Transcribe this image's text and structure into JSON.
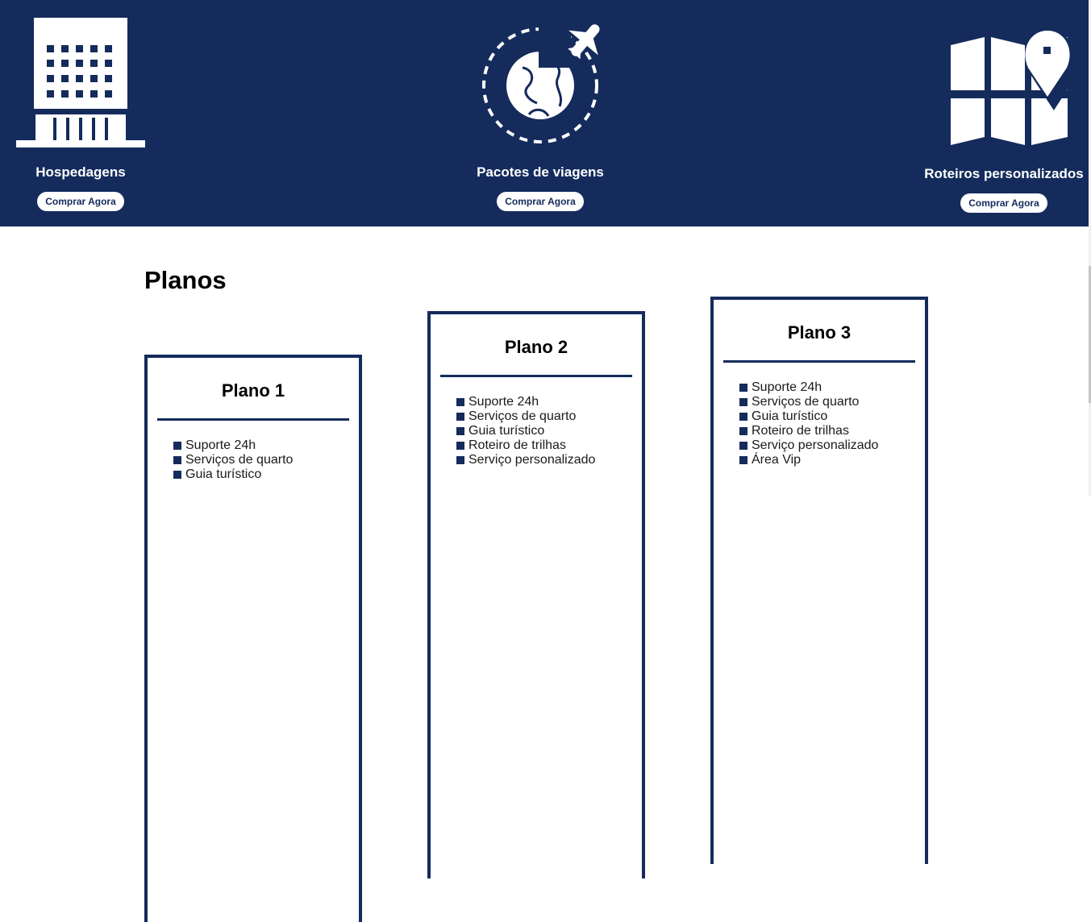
{
  "colors": {
    "navy": "#142b5c",
    "white": "#ffffff"
  },
  "services": [
    {
      "title": "Hospedagens",
      "button": "Comprar Agora",
      "icon": "hotel-building-icon"
    },
    {
      "title": "Pacotes de viagens",
      "button": "Comprar Agora",
      "icon": "globe-airplane-icon"
    },
    {
      "title": "Roteiros personalizados",
      "button": "Comprar Agora",
      "icon": "map-pin-icon"
    }
  ],
  "plans_section": {
    "title": "Planos"
  },
  "plans": [
    {
      "title": "Plano 1",
      "features": [
        "Suporte 24h",
        "Serviços de quarto",
        "Guia turístico"
      ]
    },
    {
      "title": "Plano 2",
      "features": [
        "Suporte 24h",
        "Serviços de quarto",
        "Guia turístico",
        "Roteiro de trilhas",
        "Serviço personalizado"
      ]
    },
    {
      "title": "Plano 3",
      "features": [
        "Suporte 24h",
        "Serviços de quarto",
        "Guia turístico",
        "Roteiro de trilhas",
        "Serviço personalizado",
        "Área Vip"
      ]
    }
  ]
}
